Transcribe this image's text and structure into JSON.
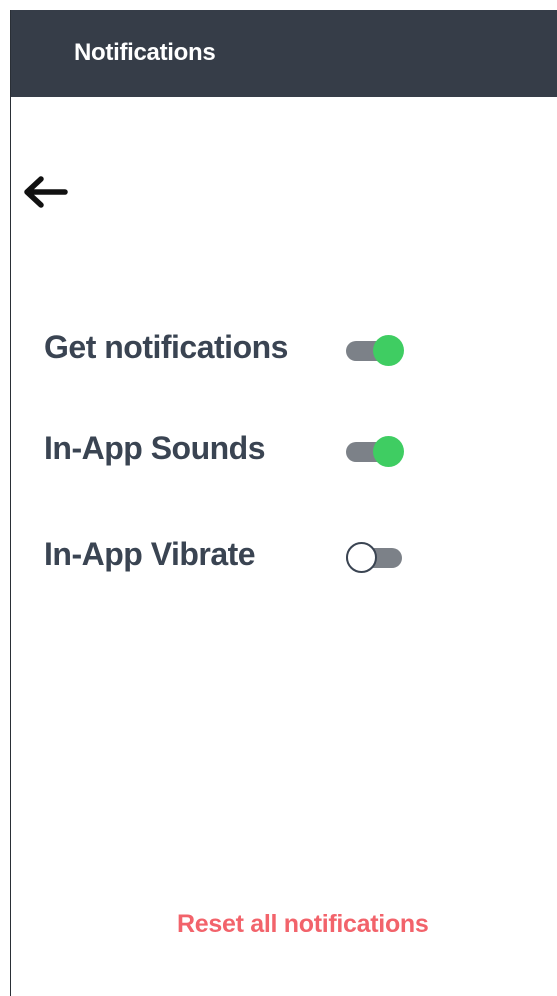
{
  "header": {
    "title": "Notifications"
  },
  "navigation": {
    "back_icon": "arrow-left-icon"
  },
  "settings": [
    {
      "label": "Get notifications",
      "enabled": true
    },
    {
      "label": "In-App Sounds",
      "enabled": true
    },
    {
      "label": "In-App Vibrate",
      "enabled": false
    }
  ],
  "footer": {
    "reset_label": "Reset all notifications"
  },
  "colors": {
    "header_bg": "#363d48",
    "toggle_on": "#3fcd62",
    "toggle_track": "#7c8188",
    "reset_accent": "#f2636b",
    "label_text": "#3a4452"
  }
}
